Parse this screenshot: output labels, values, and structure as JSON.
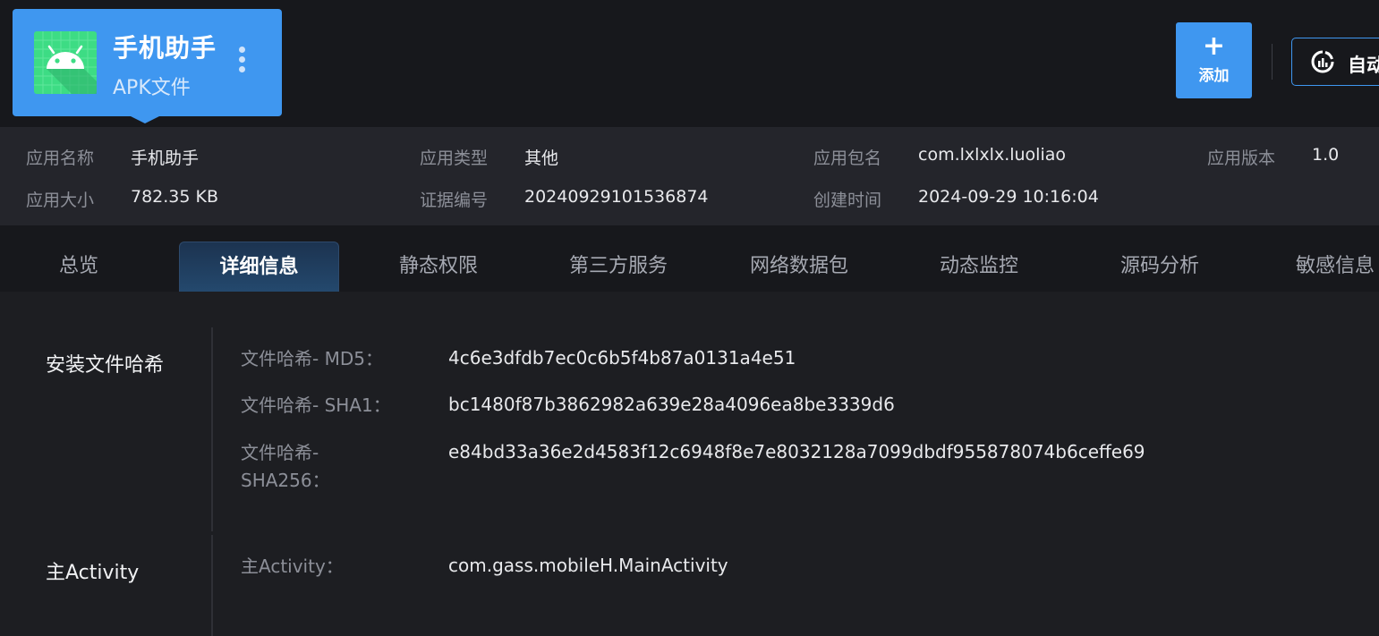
{
  "app": {
    "name": "手机助手",
    "type_label": "APK文件",
    "icon": "android-icon"
  },
  "toolbar": {
    "add_label": "添加",
    "add_icon": "+",
    "auto_label": "自动"
  },
  "info": {
    "name_label": "应用名称",
    "name_value": "手机助手",
    "type_label": "应用类型",
    "type_value": "其他",
    "package_label": "应用包名",
    "package_value": "com.lxlxlx.luoliao",
    "version_label": "应用版本",
    "version_value": "1.0",
    "size_label": "应用大小",
    "size_value": "782.35 KB",
    "cert_label": "证据编号",
    "cert_value": "20240929101536874",
    "created_label": "创建时间",
    "created_value": "2024-09-29 10:16:04"
  },
  "tabs": [
    "总览",
    "详细信息",
    "静态权限",
    "第三方服务",
    "网络数据包",
    "动态监控",
    "源码分析",
    "敏感信息"
  ],
  "active_tab": "详细信息",
  "sections": {
    "hash": {
      "title": "安装文件哈希",
      "md5_label": "文件哈希- MD5：",
      "md5_value": "4c6e3dfdb7ec0c6b5f4b87a0131a4e51",
      "sha1_label": "文件哈希- SHA1：",
      "sha1_value": "bc1480f87b3862982a639e28a4096ea8be3339d6",
      "sha256_label": "文件哈希- SHA256：",
      "sha256_value": "e84bd33a36e2d4583f12c6948f8e7e8032128a7099dbdf955878074b6ceffe69"
    },
    "activity": {
      "title": "主Activity",
      "label": "主Activity：",
      "value": "com.gass.mobileH.MainActivity"
    }
  },
  "colors": {
    "accent": "#3f97f0",
    "background": "#1d1e22",
    "header_background": "#17181c",
    "info_background": "#24252b"
  }
}
